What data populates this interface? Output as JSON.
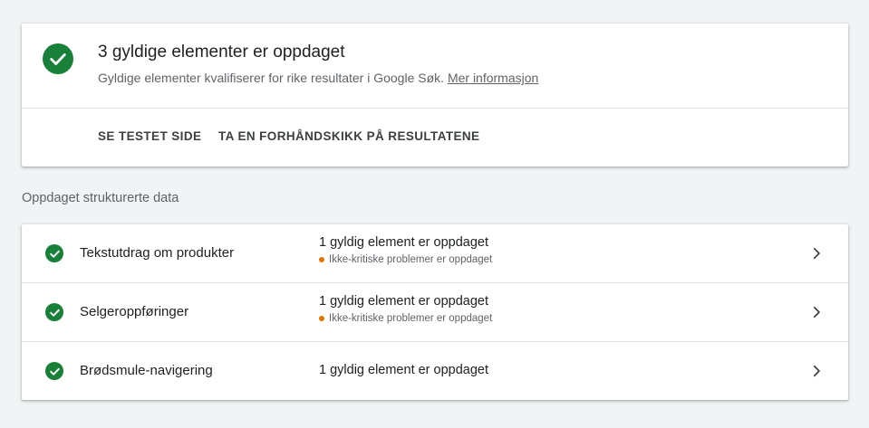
{
  "summary": {
    "title": "3 gyldige elementer er oppdaget",
    "subtitle": "Gyldige elementer kvalifiserer for rike resultater i Google Søk.",
    "link_label": "Mer informasjon",
    "actions": [
      {
        "label": "SE TESTET SIDE"
      },
      {
        "label": "TA EN FORHÅNDSKIKK PÅ RESULTATENE"
      }
    ]
  },
  "section_label": "Oppdaget strukturerte data",
  "items": [
    {
      "name": "Tekstutdrag om produkter",
      "status": "1 gyldig element er oppdaget",
      "warning": "Ikke-kritiske problemer er oppdaget"
    },
    {
      "name": "Selgeroppføringer",
      "status": "1 gyldig element er oppdaget",
      "warning": "Ikke-kritiske problemer er oppdaget"
    },
    {
      "name": "Brødsmule-navigering",
      "status": "1 gyldig element er oppdaget"
    }
  ],
  "colors": {
    "valid": "#188038",
    "warning": "#e37400",
    "background": "#f1f3f4"
  },
  "icons": [
    "check-circle-icon",
    "chevron-right-icon",
    "warning-dot-icon"
  ]
}
